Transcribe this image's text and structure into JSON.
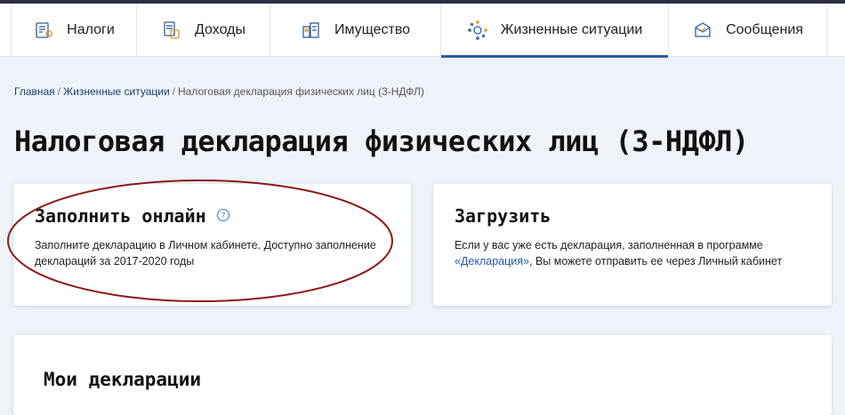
{
  "nav": {
    "items": [
      {
        "label": "Налоги",
        "icon": "tax-document-icon"
      },
      {
        "label": "Доходы",
        "icon": "income-icon"
      },
      {
        "label": "Имущество",
        "icon": "property-icon"
      },
      {
        "label": "Жизненные ситуации",
        "icon": "life-situations-icon",
        "active": true
      },
      {
        "label": "Сообщения",
        "icon": "messages-icon"
      }
    ]
  },
  "breadcrumb": {
    "home": "Главная",
    "section": "Жизненные ситуации",
    "current": "Налоговая декларация физических лиц (3-НДФЛ)"
  },
  "page": {
    "title": "Налоговая декларация физических лиц (3-НДФЛ)"
  },
  "fill_online": {
    "title": "Заполнить онлайн",
    "text": "Заполните декларацию в Личном кабинете. Доступно заполнение деклараций за 2017-2020 годы"
  },
  "upload": {
    "title": "Загрузить",
    "text_before": "Если у вас уже есть декларация, заполненная в программе ",
    "link": "«Декларация»",
    "text_after": ", Вы можете отправить ее через Личный кабинет"
  },
  "my_declarations": {
    "title": "Мои декларации"
  },
  "colors": {
    "accent": "#2a5d9f",
    "link": "#1e5aa8",
    "annotation": "#8b1a1a"
  }
}
